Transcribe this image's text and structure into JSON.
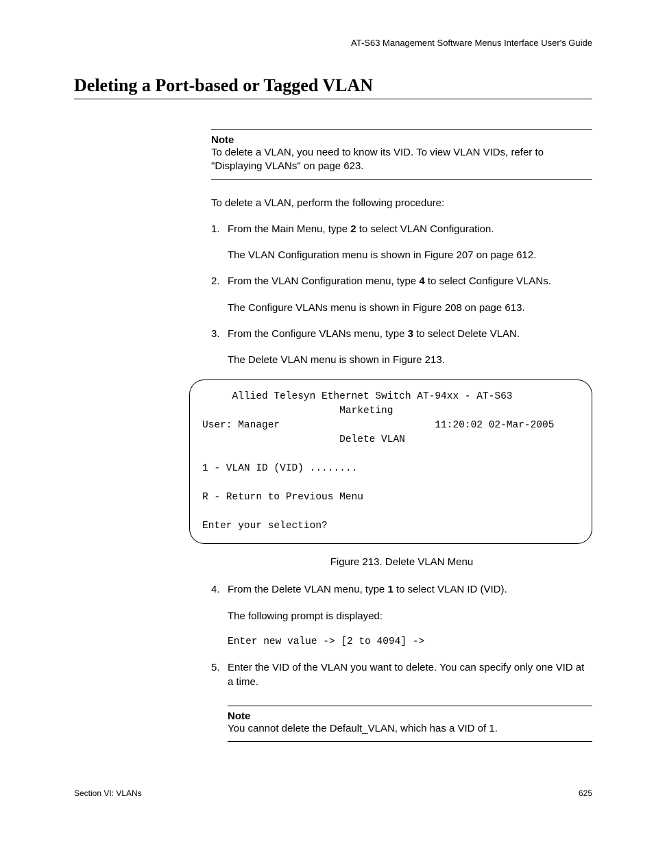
{
  "header": {
    "guide_title": "AT-S63 Management Software Menus Interface User's Guide"
  },
  "section_title": "Deleting a Port-based or Tagged VLAN",
  "note1": {
    "label": "Note",
    "text": "To delete a VLAN, you need to know its VID. To view VLAN VIDs, refer to \"Displaying VLANs\" on page 623."
  },
  "intro": "To delete a VLAN, perform the following procedure:",
  "steps": {
    "s1": {
      "num": "1.",
      "pre": "From the Main Menu, type ",
      "bold": "2",
      "post": " to select VLAN Configuration.",
      "sub": "The VLAN Configuration menu is shown in Figure 207 on page 612."
    },
    "s2": {
      "num": "2.",
      "pre": "From the VLAN Configuration menu, type ",
      "bold": "4",
      "post": " to select Configure VLANs.",
      "sub": "The Configure VLANs menu is shown in Figure 208 on page 613."
    },
    "s3": {
      "num": "3.",
      "pre": "From the Configure VLANs menu, type ",
      "bold": "3",
      "post": " to select Delete VLAN.",
      "sub": "The Delete VLAN menu is shown in Figure 213."
    },
    "s4": {
      "num": "4.",
      "pre": "From the Delete VLAN menu, type ",
      "bold": "1",
      "post": " to select VLAN ID (VID).",
      "sub": "The following prompt is displayed:",
      "prompt": "Enter new value -> [2 to 4094] ->"
    },
    "s5": {
      "num": "5.",
      "text": "Enter the VID of the VLAN you want to delete. You can specify only one VID at a time."
    }
  },
  "terminal": {
    "line1": "     Allied Telesyn Ethernet Switch AT-94xx - AT-S63",
    "line2": "                       Marketing",
    "line3a": "User: Manager",
    "line3b": "11:20:02 02-Mar-2005",
    "line4": "                       Delete VLAN",
    "line5": "",
    "line6": "1 - VLAN ID (VID) ........",
    "line7": "",
    "line8": "R - Return to Previous Menu",
    "line9": "",
    "line10": "Enter your selection?"
  },
  "figure_caption": "Figure 213. Delete VLAN Menu",
  "note2": {
    "label": "Note",
    "text": "You cannot delete the Default_VLAN, which has a VID of 1."
  },
  "footer": {
    "left": "Section VI: VLANs",
    "right": "625"
  }
}
